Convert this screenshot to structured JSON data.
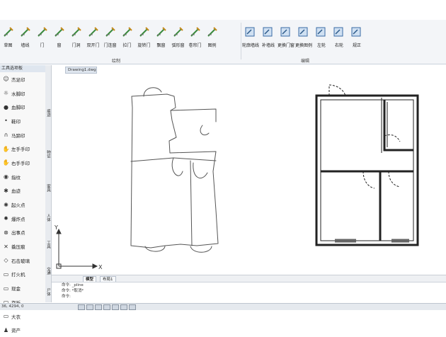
{
  "ribbon": {
    "draw_tools": [
      {
        "label": "草图",
        "icon": "sketch-icon"
      },
      {
        "label": "墙线",
        "icon": "wall-icon"
      },
      {
        "label": "门",
        "icon": "door-icon"
      },
      {
        "label": "窗",
        "icon": "window-icon"
      },
      {
        "label": "门洞",
        "icon": "door-opening-icon"
      },
      {
        "label": "双开门",
        "icon": "double-door-icon"
      },
      {
        "label": "门连窗",
        "icon": "door-window-icon"
      },
      {
        "label": "拉门",
        "icon": "sliding-door-icon"
      },
      {
        "label": "旋转门",
        "icon": "revolving-door-icon"
      },
      {
        "label": "飘窗",
        "icon": "bay-window-icon"
      },
      {
        "label": "弧形窗",
        "icon": "arc-window-icon"
      },
      {
        "label": "卷帘门",
        "icon": "rolling-door-icon"
      },
      {
        "label": "图例",
        "icon": "legend-icon"
      }
    ],
    "edit_tools": [
      {
        "label": "轮廓墙线",
        "icon": "outline-wall-icon"
      },
      {
        "label": "补墙线",
        "icon": "patch-wall-icon"
      },
      {
        "label": "更换门窗",
        "icon": "replace-door-icon"
      },
      {
        "label": "更换图例",
        "icon": "replace-legend-icon"
      },
      {
        "label": "左轮",
        "icon": "left-wheel-icon"
      },
      {
        "label": "右轮",
        "icon": "right-wheel-icon"
      },
      {
        "label": "规正",
        "icon": "normalize-icon"
      }
    ],
    "group_draw": "绘制",
    "group_edit": "编辑"
  },
  "palette": {
    "title": "工具选项板",
    "items": [
      {
        "label": "杰足印",
        "icon": "footprint-icon"
      },
      {
        "label": "水脚印",
        "icon": "water-footprint-icon"
      },
      {
        "label": "血脚印",
        "icon": "blood-footprint-icon"
      },
      {
        "label": "鞋印",
        "icon": "shoe-print-icon"
      },
      {
        "label": "马蹄印",
        "icon": "hoof-print-icon"
      },
      {
        "label": "左手手印",
        "icon": "left-hand-icon"
      },
      {
        "label": "右手手印",
        "icon": "right-hand-icon"
      },
      {
        "label": "指纹",
        "icon": "fingerprint-icon"
      },
      {
        "label": "血迹",
        "icon": "blood-stain-icon"
      },
      {
        "label": "起火点",
        "icon": "fire-point-icon"
      },
      {
        "label": "爆炸点",
        "icon": "explosion-icon"
      },
      {
        "label": "出事点",
        "icon": "incident-point-icon"
      },
      {
        "label": "撬压痕",
        "icon": "pry-mark-icon"
      },
      {
        "label": "石击玻璃",
        "icon": "broken-glass-icon"
      },
      {
        "label": "打火机",
        "icon": "lighter-icon"
      },
      {
        "label": "现金",
        "icon": "cash-icon"
      },
      {
        "label": "存折",
        "icon": "passbook-icon"
      },
      {
        "label": "大衣",
        "icon": "coat-icon"
      },
      {
        "label": "资产",
        "icon": "asset-icon"
      }
    ]
  },
  "vtabs": [
    "痕迹",
    "物证",
    "家具",
    "人体",
    "工具",
    "交通",
    "尸体"
  ],
  "document_tab": "Drawing1.dwg",
  "layout_tabs": [
    "模型",
    "布局1"
  ],
  "command_lines": [
    "命令: _pline",
    "命令: *取消*",
    "命令:"
  ],
  "status": {
    "coords": "36, 4294, 0"
  },
  "ucs": {
    "x": "X",
    "y": "Y"
  }
}
